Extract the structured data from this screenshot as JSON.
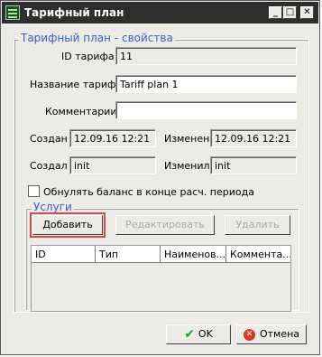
{
  "window": {
    "title": "Тарифный план"
  },
  "titlebar_buttons": {
    "minimize": "_",
    "maximize": "□",
    "close": "✕"
  },
  "properties": {
    "legend": "Тарифный план - свойства",
    "id_label": "ID тарифа",
    "id_value": "11",
    "name_label": "Название тарифа",
    "name_value": "Tariff plan 1",
    "comments_label": "Комментарии",
    "comments_value": "",
    "created_label": "Создан",
    "created_value": "12.09.16 12:21",
    "modified_label": "Изменен",
    "modified_value": "12.09.16 12:21",
    "creator_label": "Создал",
    "creator_value": "init",
    "modifier_label": "Изменил",
    "modifier_value": "init",
    "reset_balance_label": "Обнулять баланс в конце расч. периода",
    "reset_balance_checked": false
  },
  "services": {
    "legend": "Услуги",
    "add": "Добавить",
    "edit": "Редактировать",
    "delete": "Удалить",
    "columns": [
      "ID",
      "Тип",
      "Наименов...",
      "Коммента..."
    ],
    "rows": []
  },
  "footer": {
    "ok": "OK",
    "cancel": "Отмена"
  },
  "icons": {
    "ok": "check-icon",
    "cancel": "cancel-icon",
    "app": "table-icon"
  },
  "colors": {
    "legend": "#3b5dc4",
    "highlight": "#d94a4a",
    "titlebar": "#2e2e2e"
  }
}
